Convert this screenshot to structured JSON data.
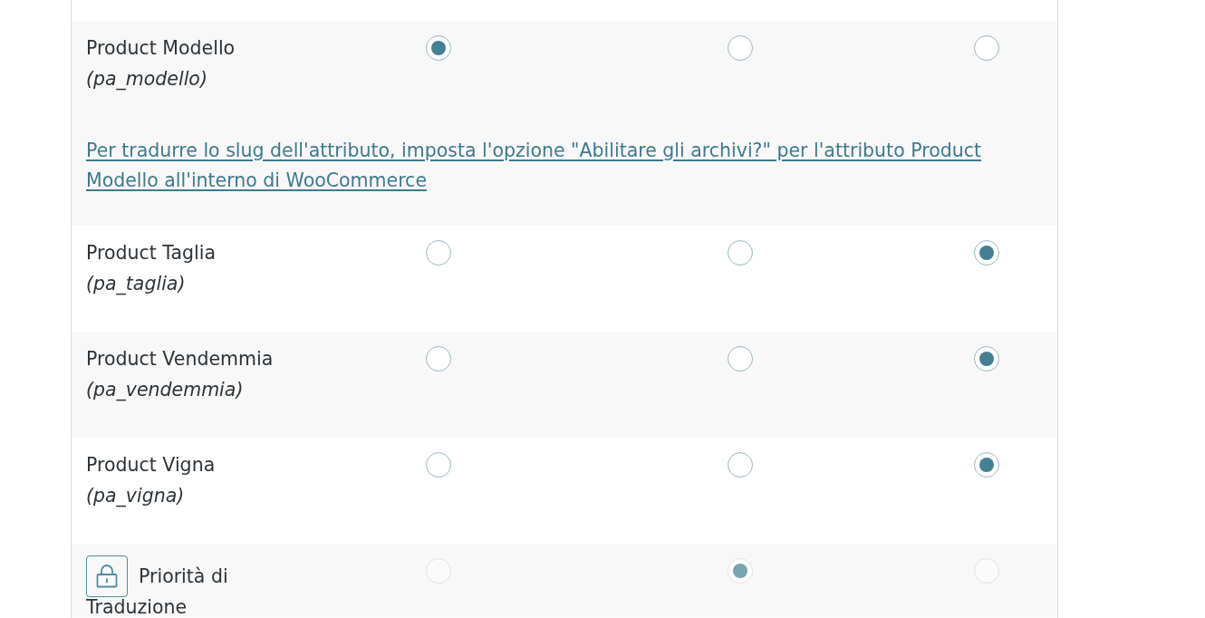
{
  "rows": [
    {
      "kind": "attribute",
      "name": "Product Modello",
      "slug": "(pa_modello)",
      "disabled": false,
      "options": [
        {
          "selected": true
        },
        {
          "selected": false
        },
        {
          "selected": false
        }
      ],
      "note": "Per tradurre lo slug dell'attributo, imposta l'opzione \"Abilitare gli archivi?\" per l'attributo Product Modello all'interno di WooCommerce"
    },
    {
      "kind": "attribute",
      "name": "Product Taglia",
      "slug": "(pa_taglia)",
      "disabled": false,
      "options": [
        {
          "selected": false
        },
        {
          "selected": false
        },
        {
          "selected": true
        }
      ]
    },
    {
      "kind": "attribute",
      "name": "Product Vendemmia",
      "slug": "(pa_vendemmia)",
      "disabled": false,
      "options": [
        {
          "selected": false
        },
        {
          "selected": false
        },
        {
          "selected": true
        }
      ]
    },
    {
      "kind": "attribute",
      "name": "Product Vigna",
      "slug": "(pa_vigna)",
      "disabled": false,
      "options": [
        {
          "selected": false
        },
        {
          "selected": false
        },
        {
          "selected": true
        }
      ]
    },
    {
      "kind": "setting",
      "name_lines": [
        "Priorità di",
        "Traduzione"
      ],
      "disabled": true,
      "options": [
        {
          "selected": false
        },
        {
          "selected": true
        },
        {
          "selected": false
        }
      ]
    }
  ]
}
